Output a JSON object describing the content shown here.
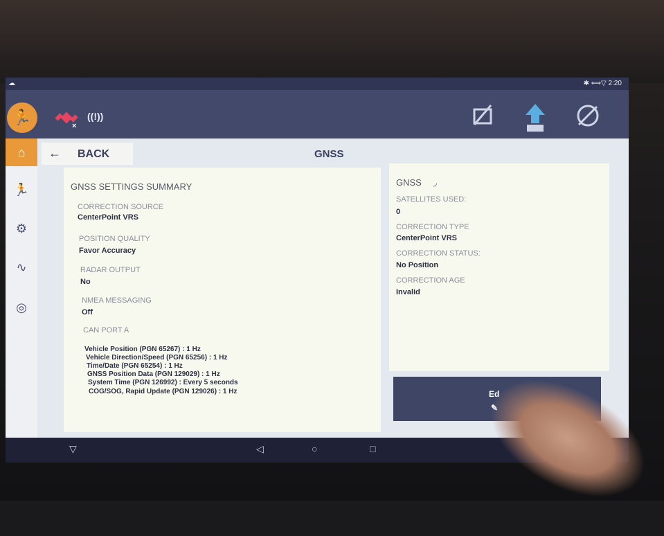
{
  "status_bar": {
    "left_icon": "cloud-warning-icon",
    "right": "✱ ⟺▽ 2:20"
  },
  "topbar": {
    "signal_label": "((!))",
    "satellite_icon": "satellite-icon",
    "icons": [
      "field-boundary-icon",
      "vehicle-upload-icon",
      "no-steer-icon"
    ]
  },
  "header": {
    "back_label": "BACK",
    "title": "GNSS"
  },
  "summary": {
    "title": "GNSS SETTINGS SUMMARY",
    "items": [
      {
        "label": "CORRECTION SOURCE",
        "value": "CenterPoint VRS"
      },
      {
        "label": "POSITION QUALITY",
        "value": "Favor Accuracy"
      },
      {
        "label": "RADAR OUTPUT",
        "value": "No"
      },
      {
        "label": "NMEA MESSAGING",
        "value": "Off"
      }
    ],
    "can_label": "CAN PORT A",
    "can_messages": [
      "Vehicle Position (PGN 65267) : 1 Hz",
      "Vehicle Direction/Speed (PGN 65256) : 1 Hz",
      "Time/Date (PGN 65254) : 1 Hz",
      "GNSS Position Data (PGN 129029) : 1 Hz",
      "System Time (PGN 126992) : Every 5 seconds",
      "COG/SOG, Rapid Update (PGN 129026) : 1 Hz"
    ]
  },
  "status": {
    "title": "GNSS",
    "items": [
      {
        "label": "SATELLITES USED:",
        "value": "0"
      },
      {
        "label": "CORRECTION TYPE",
        "value": "CenterPoint VRS"
      },
      {
        "label": "CORRECTION STATUS:",
        "value": "No Position"
      },
      {
        "label": "CORRECTION AGE",
        "value": "Invalid"
      }
    ]
  },
  "edit": {
    "label": "Ed"
  },
  "accent": "#e9983a"
}
